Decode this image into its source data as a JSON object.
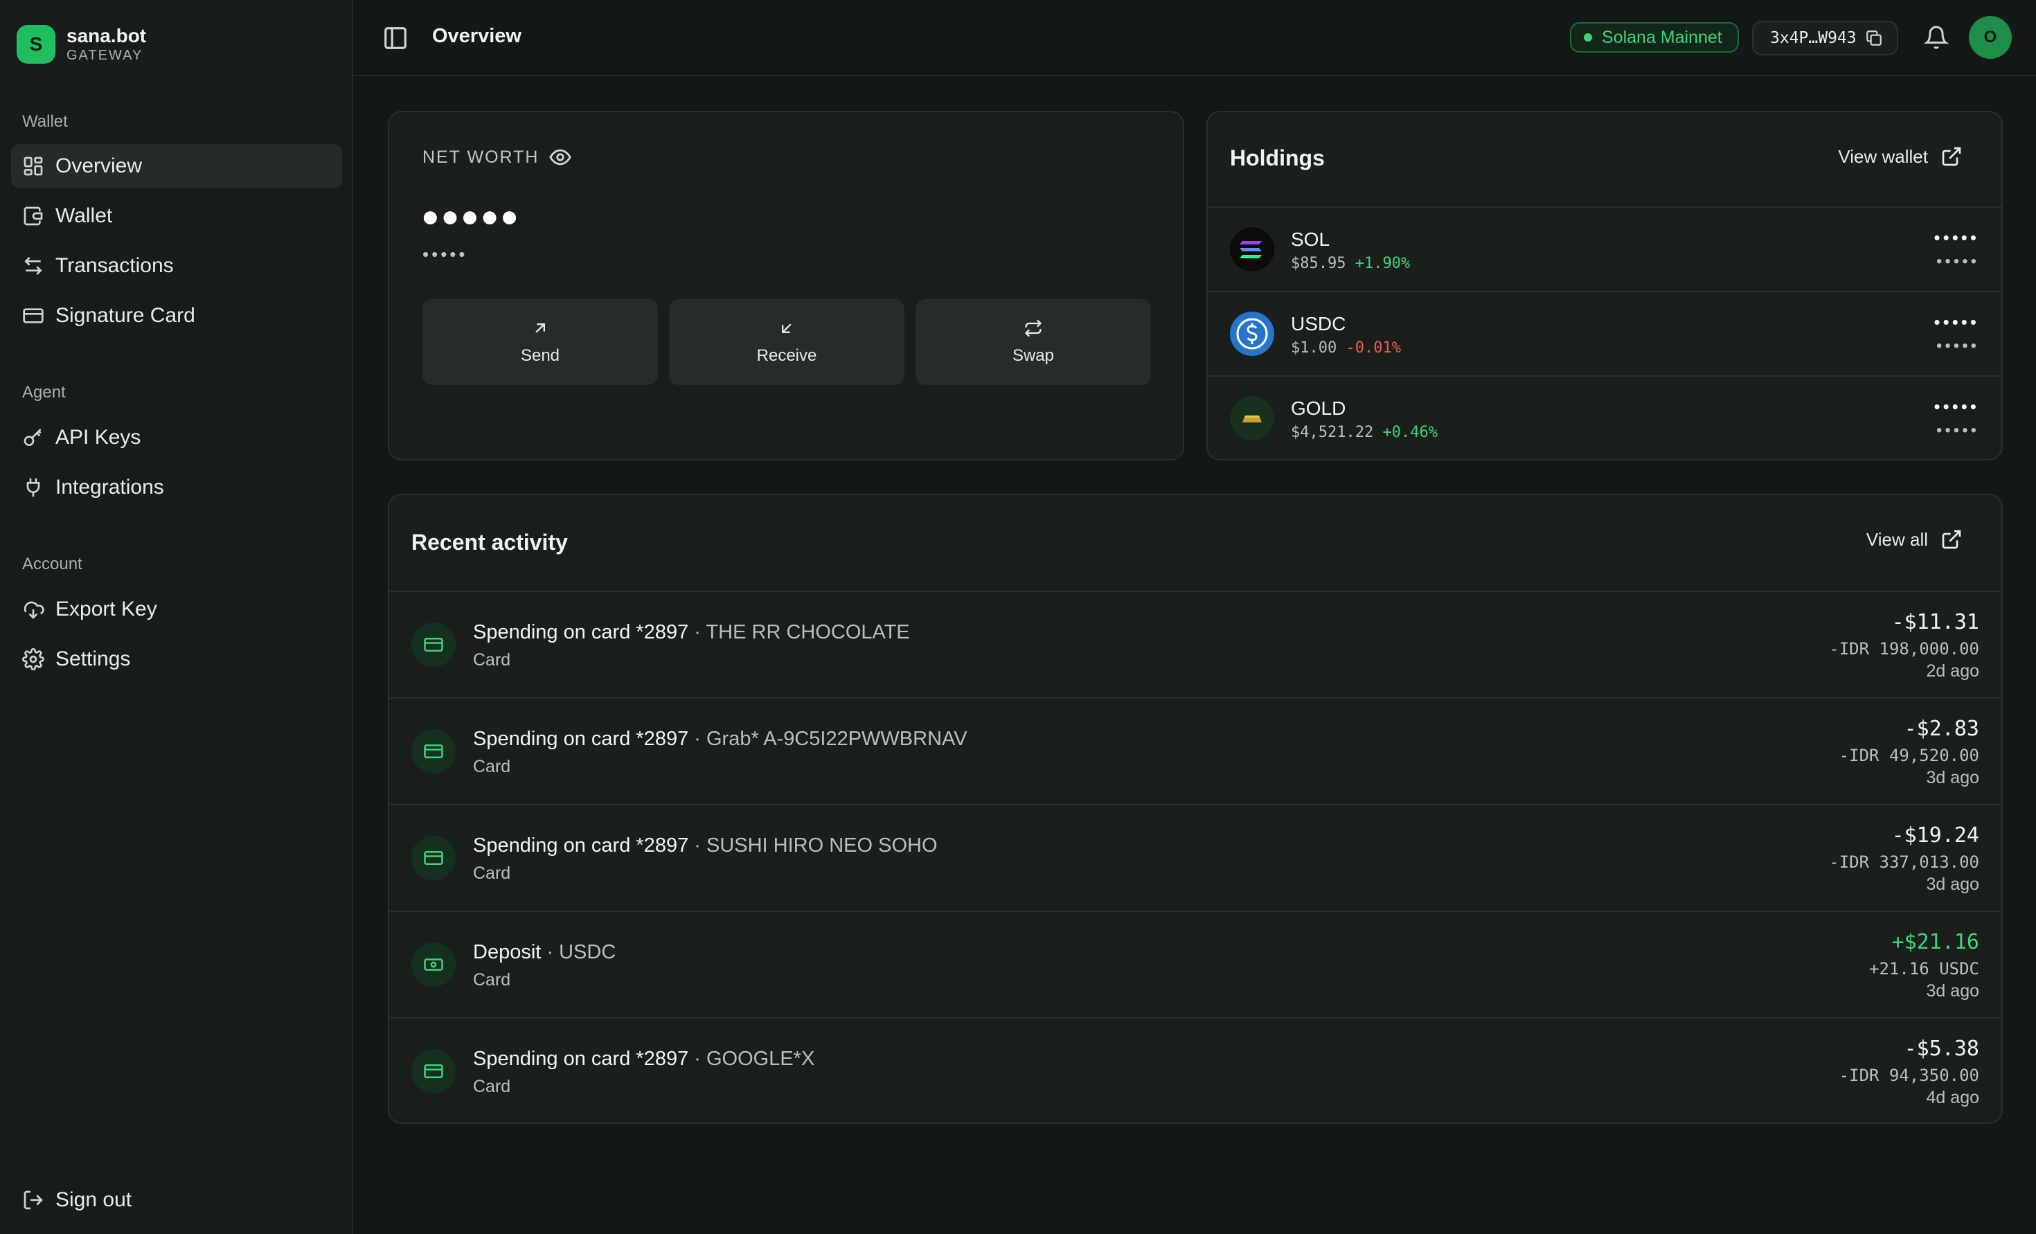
{
  "brand": {
    "initial": "S",
    "name": "sana.bot",
    "sub": "GATEWAY"
  },
  "sidebar": {
    "sections": [
      {
        "title": "Wallet",
        "items": [
          {
            "label": "Overview",
            "icon": "grid-icon",
            "active": true
          },
          {
            "label": "Wallet",
            "icon": "wallet-icon"
          },
          {
            "label": "Transactions",
            "icon": "arrows-exchange-icon"
          },
          {
            "label": "Signature Card",
            "icon": "credit-card-icon"
          }
        ]
      },
      {
        "title": "Agent",
        "items": [
          {
            "label": "API Keys",
            "icon": "key-icon"
          },
          {
            "label": "Integrations",
            "icon": "plug-icon"
          }
        ]
      },
      {
        "title": "Account",
        "items": [
          {
            "label": "Export Key",
            "icon": "cloud-download-icon"
          },
          {
            "label": "Settings",
            "icon": "gear-icon"
          }
        ]
      }
    ],
    "signout": "Sign out"
  },
  "header": {
    "title": "Overview",
    "network": "Solana Mainnet",
    "address": "3x4P…W943",
    "avatar": "O"
  },
  "networth": {
    "label": "NET WORTH",
    "value": "●●●●●",
    "sub": "•••••",
    "actions": [
      "Send",
      "Receive",
      "Swap"
    ]
  },
  "holdings": {
    "title": "Holdings",
    "link": "View wallet",
    "items": [
      {
        "symbol": "SOL",
        "price": "$85.95",
        "change": "+1.90%",
        "dir": "pos",
        "amount": "•••••",
        "value": "•••••"
      },
      {
        "symbol": "USDC",
        "price": "$1.00",
        "change": "-0.01%",
        "dir": "neg",
        "amount": "•••••",
        "value": "•••••"
      },
      {
        "symbol": "GOLD",
        "price": "$4,521.22",
        "change": "+0.46%",
        "dir": "pos",
        "amount": "•••••",
        "value": "•••••"
      }
    ]
  },
  "activity": {
    "title": "Recent activity",
    "link": "View all",
    "items": [
      {
        "title": "Spending on card *2897",
        "merchant": "THE RR CHOCOLATE",
        "type": "Card",
        "amount": "-$11.31",
        "alt": "-IDR 198,000.00",
        "time": "2d ago",
        "kind": "card"
      },
      {
        "title": "Spending on card *2897",
        "merchant": "Grab* A-9C5I22PWWBRNAV",
        "type": "Card",
        "amount": "-$2.83",
        "alt": "-IDR 49,520.00",
        "time": "3d ago",
        "kind": "card"
      },
      {
        "title": "Spending on card *2897",
        "merchant": "SUSHI HIRO NEO SOHO",
        "type": "Card",
        "amount": "-$19.24",
        "alt": "-IDR 337,013.00",
        "time": "3d ago",
        "kind": "card"
      },
      {
        "title": "Deposit",
        "merchant": "USDC",
        "type": "Card",
        "amount": "+$21.16",
        "alt": "+21.16 USDC",
        "time": "3d ago",
        "kind": "deposit"
      },
      {
        "title": "Spending on card *2897",
        "merchant": "GOOGLE*X",
        "type": "Card",
        "amount": "-$5.38",
        "alt": "-IDR 94,350.00",
        "time": "4d ago",
        "kind": "card"
      }
    ]
  },
  "colors": {
    "accent": "#1fbf5f",
    "positive": "#3fd37b",
    "negative": "#f05b52",
    "background": "#141816",
    "card": "#1a1f1c"
  }
}
